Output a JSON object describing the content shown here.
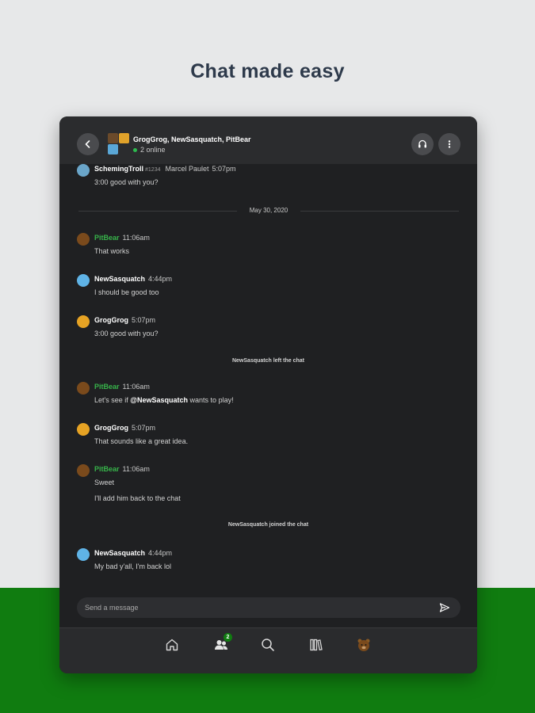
{
  "headline": "Chat made easy",
  "colors": {
    "accent": "#107c10",
    "background": "#e7e8e9",
    "panel": "#1f2022",
    "online": "#2dba4e",
    "gamertag_highlight": "#37b34a"
  },
  "header": {
    "title": "GrogGrog, NewSasquatch, PitBear",
    "online": "2 online",
    "back_icon": "chevron-left-icon",
    "headset_icon": "headset-icon",
    "more_icon": "more-vertical-icon"
  },
  "messages": [
    {
      "name": "SchemingTroll",
      "tag": "#1234",
      "realname": "Marcel Paulet",
      "time": "5:07pm",
      "lines": [
        "3:00 good with you?"
      ]
    },
    {
      "name": "PitBear",
      "time": "11:06am",
      "lines": [
        "That works"
      ]
    },
    {
      "name": "NewSasquatch",
      "time": "4:44pm",
      "lines": [
        "I should be good too"
      ]
    },
    {
      "name": "GrogGrog",
      "time": "5:07pm",
      "lines": [
        "3:00 good with you?"
      ]
    },
    {
      "name": "PitBear",
      "time": "11:06am",
      "pre": "Let's see if ",
      "mention": "@NewSasquatch",
      "post": " wants to play!"
    },
    {
      "name": "GrogGrog",
      "time": "5:07pm",
      "lines": [
        "That sounds like a great idea."
      ]
    },
    {
      "name": "PitBear",
      "time": "11:06am",
      "lines": [
        "Sweet",
        "I'll add him back to the chat"
      ]
    },
    {
      "name": "NewSasquatch",
      "time": "4:44pm",
      "lines": [
        "My bad y'all, I'm back lol"
      ]
    }
  ],
  "date_divider": "May 30, 2020",
  "system": {
    "left": "NewSasquatch left the chat",
    "joined": "NewSasquatch joined the chat"
  },
  "composer": {
    "placeholder": "Send a message",
    "send_icon": "send-icon"
  },
  "nav": {
    "items": [
      "home-icon",
      "friends-icon",
      "search-icon",
      "library-icon",
      "profile-icon"
    ],
    "friends_badge": "2"
  }
}
